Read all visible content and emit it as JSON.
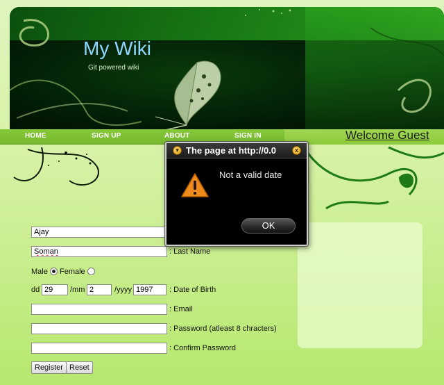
{
  "site": {
    "title": "My Wiki",
    "subtitle": "Git powered wiki"
  },
  "nav": {
    "items": [
      {
        "label": "HOME"
      },
      {
        "label": "SIGN UP"
      },
      {
        "label": "ABOUT"
      },
      {
        "label": "SIGN IN"
      }
    ],
    "welcome": "Welcome Guest"
  },
  "form": {
    "first_name_value": "Ajay",
    "last_name_value": "Soman",
    "last_name_label": ": Last Name",
    "gender_male_label": "Male",
    "gender_female_label": "Female",
    "gender_selected": "Male",
    "dob_dd_label": "dd",
    "dob_dd_value": "29",
    "dob_mm_label": "/mm",
    "dob_mm_value": "2",
    "dob_yyyy_label": "/yyyy",
    "dob_yyyy_value": "1997",
    "dob_label": ": Date of Birth",
    "email_value": "",
    "email_label": ": Email",
    "password_value": "",
    "password_label": ": Password (atleast 8 chracters)",
    "confirm_password_value": "",
    "confirm_password_label": ": Confirm Password",
    "register_label": "Register",
    "reset_label": "Reset"
  },
  "dialog": {
    "title": "The page at http://0.0",
    "message": "Not a valid date",
    "ok_label": "OK",
    "icon": "warning-icon"
  },
  "colors": {
    "nav_green": "#7ebf33",
    "banner_dark": "#021a05",
    "title_blue": "#8fd6ff",
    "dialog_bg": "#000000",
    "warning_orange": "#f08a1c"
  }
}
